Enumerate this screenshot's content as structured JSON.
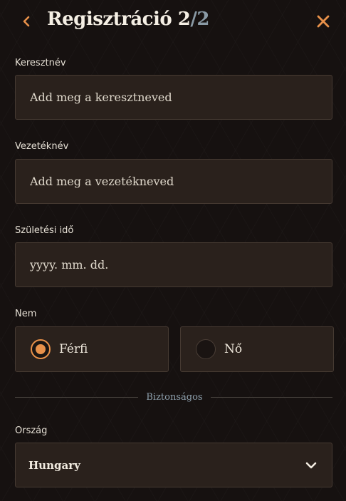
{
  "header": {
    "title": "Regisztráció 2",
    "separator": "/",
    "total": "2",
    "back_icon": "chevron-left-icon",
    "close_icon": "close-icon",
    "accent_color": "#e8914a"
  },
  "form": {
    "first_name": {
      "label": "Keresztnév",
      "placeholder": "Add meg a keresztneved",
      "value": ""
    },
    "last_name": {
      "label": "Vezetéknév",
      "placeholder": "Add meg a vezetékneved",
      "value": ""
    },
    "birth_date": {
      "label": "Születési idő",
      "placeholder": "yyyy. mm. dd.",
      "value": ""
    },
    "gender": {
      "label": "Nem",
      "options": [
        {
          "label": "Férfi",
          "selected": true
        },
        {
          "label": "Nő",
          "selected": false
        }
      ]
    },
    "section_divider": "Biztonságos",
    "country": {
      "label": "Ország",
      "value": "Hungary",
      "icon": "chevron-down-icon"
    }
  }
}
